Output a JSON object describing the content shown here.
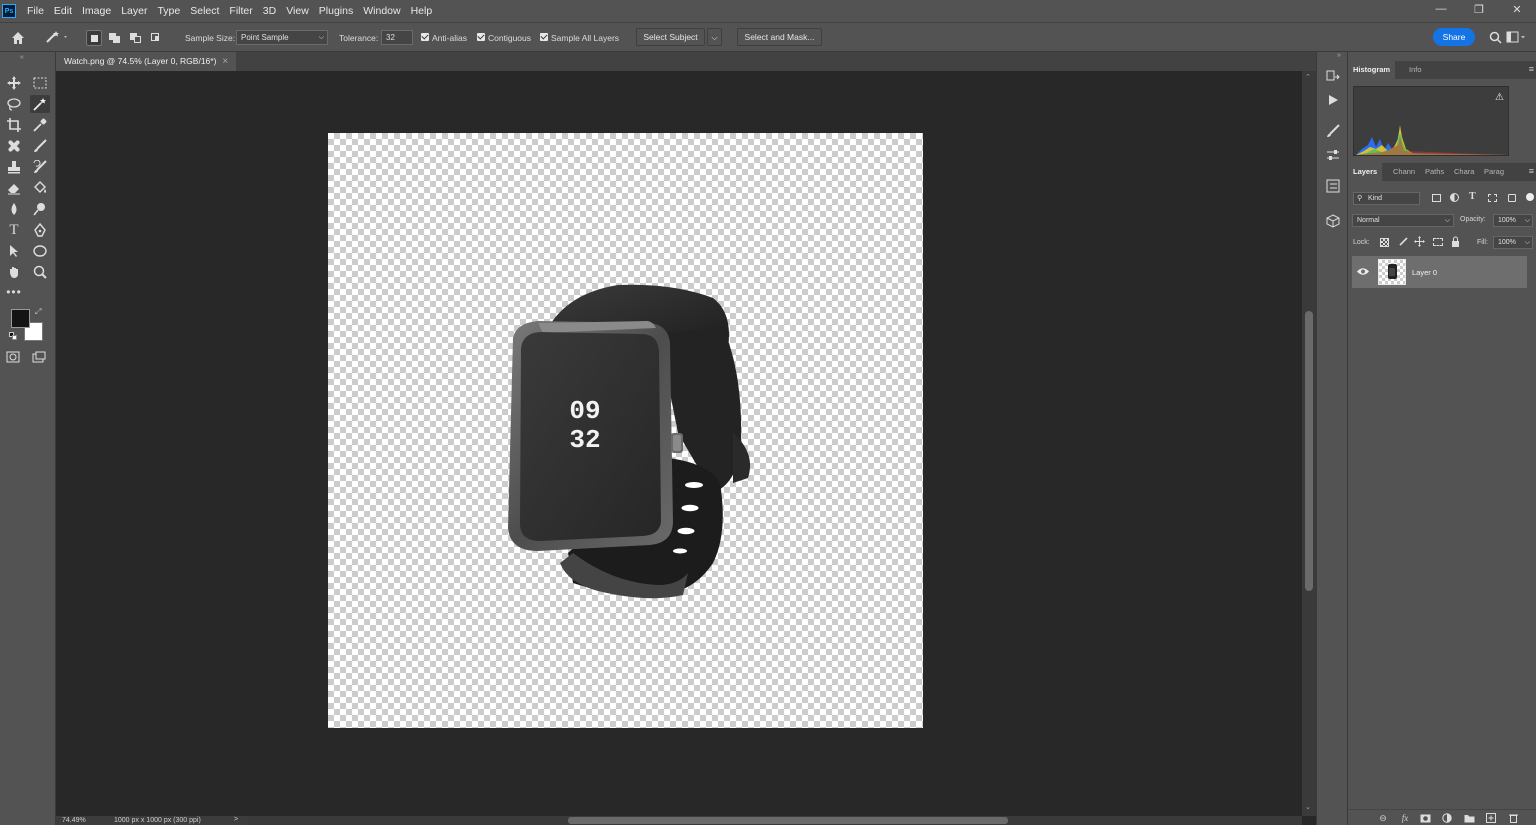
{
  "app": {
    "logo": "Ps"
  },
  "menu": [
    "File",
    "Edit",
    "Image",
    "Layer",
    "Type",
    "Select",
    "Filter",
    "3D",
    "View",
    "Plugins",
    "Window",
    "Help"
  ],
  "window_controls": {
    "minimize": "—",
    "restore": "❐",
    "close": "✕"
  },
  "options": {
    "sample_size_label": "Sample Size:",
    "sample_size_value": "Point Sample",
    "tolerance_label": "Tolerance:",
    "tolerance_value": "32",
    "anti_alias_label": "Anti-alias",
    "anti_alias_checked": true,
    "contiguous_label": "Contiguous",
    "contiguous_checked": true,
    "sample_all_layers_label": "Sample All Layers",
    "sample_all_layers_checked": true,
    "select_subject_label": "Select Subject",
    "select_and_mask_label": "Select and Mask...",
    "share_label": "Share"
  },
  "document_tab": {
    "title": "Watch.png @ 74.5% (Layer 0, RGB/16*)",
    "close": "×"
  },
  "status": {
    "zoom": "74.49%",
    "doc_info": "1000 px x 1000 px (300 ppi)",
    "arrow": ">"
  },
  "watch_display": {
    "hours": "09",
    "minutes": "32"
  },
  "histogram_panel": {
    "tabs": [
      "Histogram",
      "Info"
    ],
    "active": "Histogram",
    "warning_icon": "⚠"
  },
  "layers_panel": {
    "tabs": [
      "Layers",
      "Chann",
      "Paths",
      "Chara",
      "Parag"
    ],
    "active": "Layers",
    "filter_kind": "Kind",
    "blend_mode": "Normal",
    "opacity_label": "Opacity:",
    "opacity_value": "100%",
    "lock_label": "Lock:",
    "fill_label": "Fill:",
    "fill_value": "100%",
    "layers": [
      {
        "name": "Layer 0",
        "visible": true
      }
    ]
  },
  "colors": {
    "foreground": "#141414",
    "background": "#ffffff",
    "accent": "#1473e6"
  }
}
